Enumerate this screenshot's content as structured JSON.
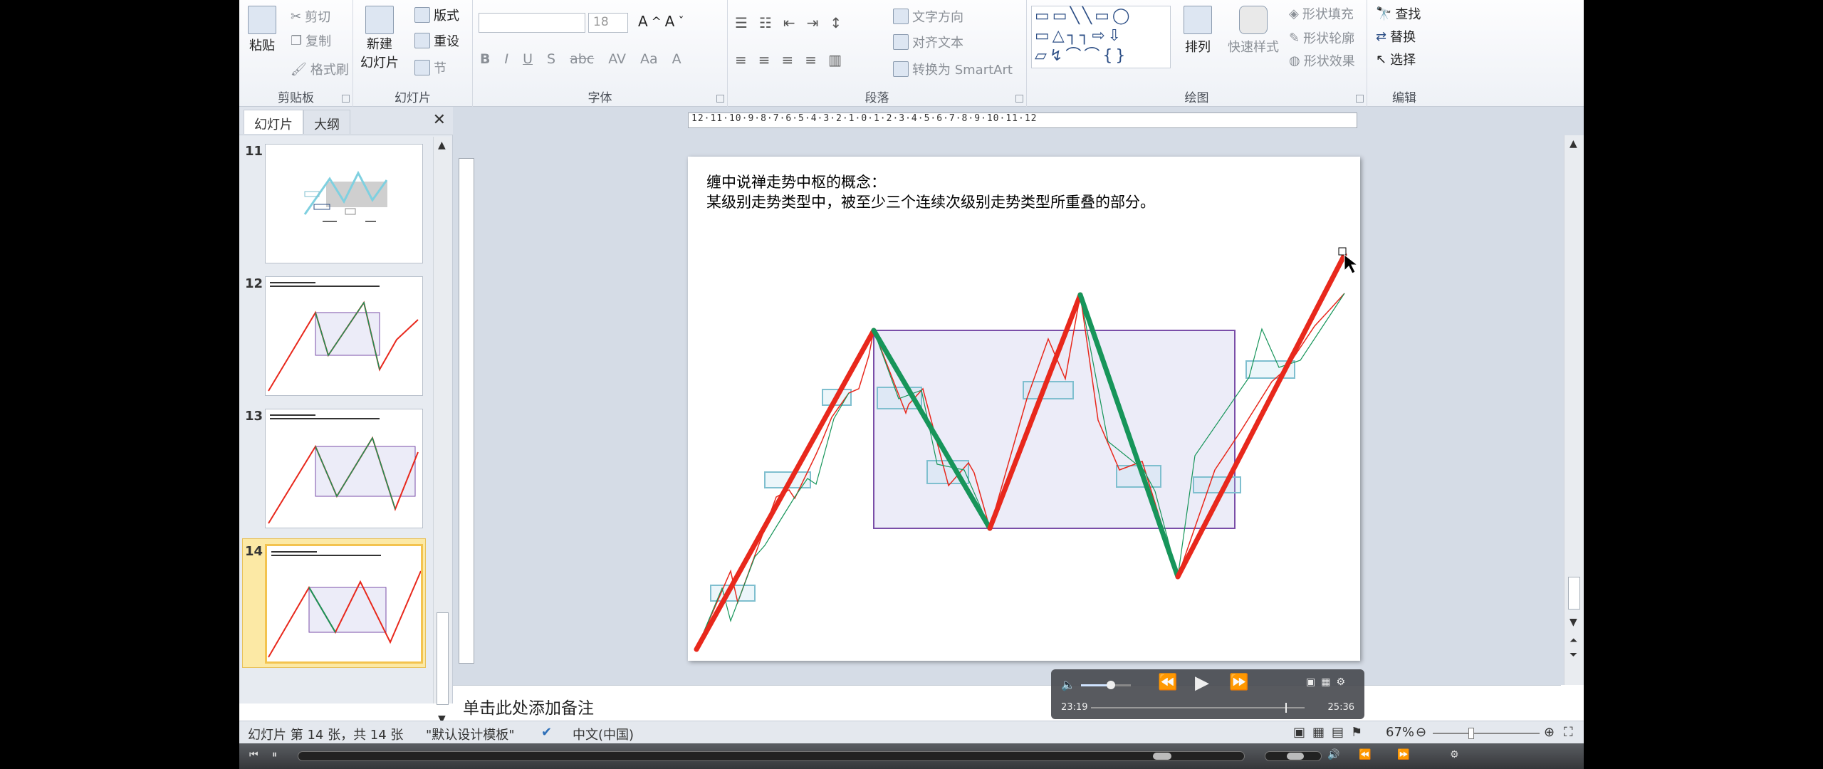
{
  "ribbon": {
    "clipboard": {
      "paste": "粘贴",
      "cut": "剪切",
      "copy": "复制",
      "format_painter": "格式刷",
      "label": "剪贴板"
    },
    "slides": {
      "new_slide_line1": "新建",
      "new_slide_line2": "幻灯片",
      "layout": "版式",
      "reset": "重设",
      "section": "节",
      "label": "幻灯片"
    },
    "font": {
      "font_size": "18",
      "label": "字体"
    },
    "paragraph": {
      "text_direction": "文字方向",
      "align_text": "对齐文本",
      "smartart": "转换为 SmartArt",
      "label": "段落"
    },
    "drawing": {
      "arrange": "排列",
      "quick_styles": "快速样式",
      "shape_fill": "形状填充",
      "shape_outline": "形状轮廓",
      "shape_effects": "形状效果",
      "label": "绘图"
    },
    "editing": {
      "find": "查找",
      "replace": "替换",
      "select": "选择",
      "label": "编辑"
    }
  },
  "left_pane": {
    "tabs": [
      "幻灯片",
      "大纲"
    ],
    "thumbnails": [
      {
        "number": "11"
      },
      {
        "number": "12"
      },
      {
        "number": "13"
      },
      {
        "number": "14"
      }
    ]
  },
  "ruler": {
    "horizontal": "12·11·10·9·8·7·6·5·4·3·2·1·0·1·2·3·4·5·6·7·8·9·10·11·12"
  },
  "slide": {
    "line1": "缠中说禅走势中枢的概念：",
    "line2": "某级别走势类型中，被至少三个连续次级别走势类型所重叠的部分。"
  },
  "notes": {
    "placeholder": "单击此处添加备注"
  },
  "video": {
    "current": "23:19",
    "total": "25:36",
    "volume_pct": 60,
    "progress_pct": 91
  },
  "statusbar": {
    "slide_info": "幻灯片 第 14 张，共 14 张",
    "theme": "\"默认设计模板\"",
    "language": "中文(中国)",
    "zoom": "67%"
  },
  "colors": {
    "up": "#e8281c",
    "down": "#17955a",
    "pivot_fill": "#ececf8",
    "pivot_stroke": "#7a4ea8",
    "small_box": "#7fbfcf"
  }
}
